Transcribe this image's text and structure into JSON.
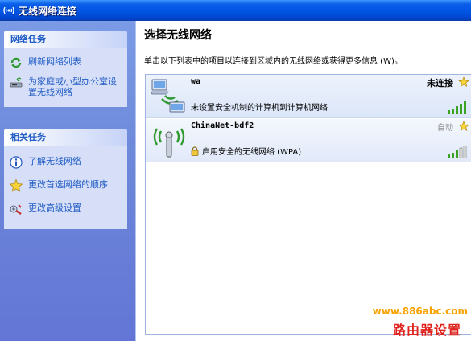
{
  "window": {
    "title": "无线网络连接",
    "title_icon": "wireless-signal-icon"
  },
  "left_pane": {
    "network_tasks": {
      "header": "网络任务",
      "items": [
        {
          "label": "刷新网络列表",
          "icon": "refresh-icon"
        },
        {
          "label": "为家庭或小型办公室设置无线网络",
          "icon": "network-setup-icon"
        }
      ]
    },
    "related_tasks": {
      "header": "相关任务",
      "items": [
        {
          "label": "了解无线网络",
          "icon": "info-icon"
        },
        {
          "label": "更改首选网络的顺序",
          "icon": "star-icon"
        },
        {
          "label": "更改高级设置",
          "icon": "settings-icon"
        }
      ]
    }
  },
  "main": {
    "title": "选择无线网络",
    "instructions": "单击以下列表中的项目以连接到区域内的无线网络或获得更多信息 (W)。",
    "networks": [
      {
        "name": "wa",
        "status": "未连接",
        "description": "未设置安全机制的计算机到计算机网络",
        "icon": "computer-to-computer-icon",
        "preferred": true,
        "signal_bars": 5,
        "secured": false
      },
      {
        "name": "ChinaNet-bdf2",
        "status": "自动",
        "description": "启用安全的无线网络 (WPA)",
        "icon": "wireless-antenna-icon",
        "preferred": true,
        "signal_bars": 3,
        "secured": true
      }
    ]
  },
  "watermark": {
    "url": "www.886abc.com",
    "text": "路由器设置"
  },
  "colors": {
    "title_bar": "#0054e3",
    "task_link": "#215dc6",
    "signal_green": "#3aa324"
  }
}
